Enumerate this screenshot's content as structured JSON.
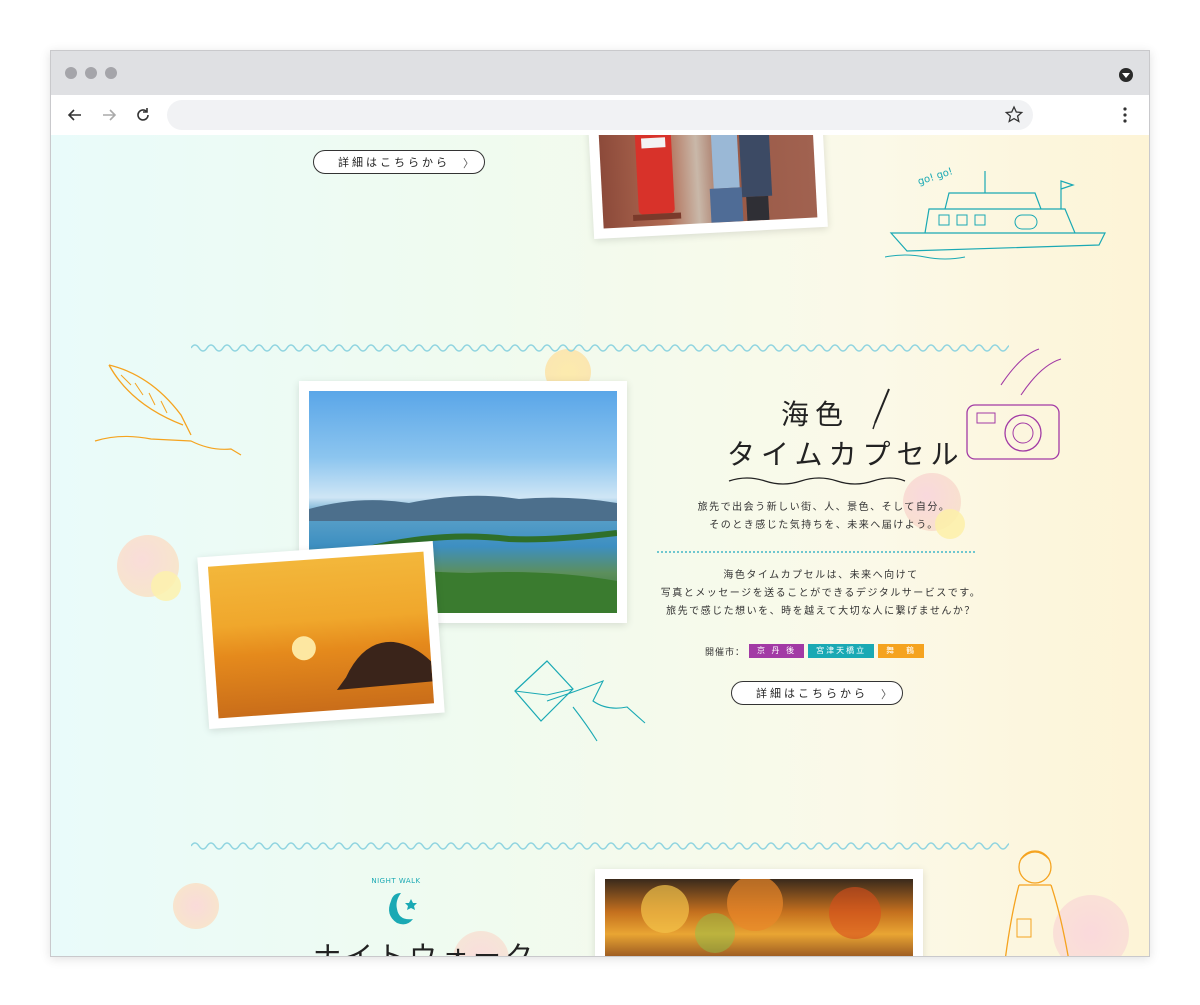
{
  "browser": {
    "url": "",
    "icons": [
      "back-arrow-icon",
      "forward-arrow-icon",
      "reload-icon",
      "star-icon",
      "kebab-menu-icon",
      "dropdown-icon"
    ]
  },
  "section_top": {
    "cta_label": "詳細はこちらから",
    "cta_chevron": "〉"
  },
  "section_timecapsule": {
    "title_line1": "海色",
    "title_line2": "タイムカプセル",
    "lead_line1": "旅先で出会う新しい街、人、景色、そして自分。",
    "lead_line2": "そのとき感じた気持ちを、未来へ届けよう。",
    "body_line1": "海色タイムカプセルは、未来へ向けて",
    "body_line2": "写真とメッセージを送ることができるデジタルサービスです。",
    "body_line3": "旅先で感じた想いを、時を越えて大切な人に繋げませんか？",
    "venue_label": "開催市：",
    "venues": [
      {
        "label": "京 丹 後",
        "color": "#a23aa5"
      },
      {
        "label": "宮津天橋立",
        "color": "#1aa9b4"
      },
      {
        "label": "舞　鶴",
        "color": "#f5a31f"
      }
    ],
    "cta_label": "詳細はこちらから",
    "cta_chevron": "〉"
  },
  "section_nightwalk": {
    "badge_text": "NIGHT WALK",
    "title": "ナイトウォーク"
  },
  "colors": {
    "accent_teal": "#1aa9b4",
    "accent_orange": "#f5a31f",
    "accent_purple": "#a23aa5",
    "wave_blue": "#8fd4e0"
  }
}
